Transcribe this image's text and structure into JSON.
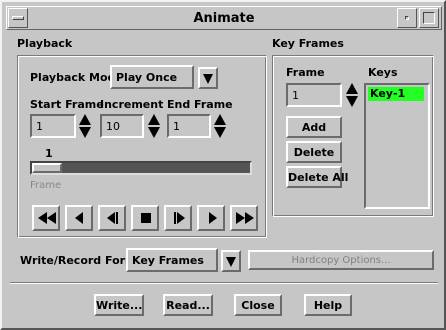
{
  "window": {
    "title": "Animate"
  },
  "playback": {
    "section_label": "Playback",
    "mode_label": "Playback Mode",
    "mode_value": "Play Once",
    "start_frame_label": "Start Frame",
    "start_frame_value": "1",
    "increment_label": "Increment",
    "increment_value": "10",
    "end_frame_label": "End Frame",
    "end_frame_value": "1",
    "slider_value_text": "1",
    "slider_label": "Frame",
    "transport_icons": [
      "fast-rewind",
      "step-back",
      "play-reverse",
      "stop",
      "play-forward",
      "step-forward",
      "fast-forward"
    ]
  },
  "keyframes": {
    "section_label": "Key Frames",
    "frame_label": "Frame",
    "frame_value": "1",
    "keys_label": "Keys",
    "keys": [
      "Key-1"
    ],
    "add_label": "Add",
    "delete_label": "Delete",
    "delete_all_label": "Delete All",
    "selected_color": "#22ff22"
  },
  "write_record": {
    "label": "Write/Record Format",
    "value": "Key Frames",
    "hardcopy_label": "Hardcopy Options..."
  },
  "footer": {
    "write_label": "Write...",
    "read_label": "Read...",
    "close_label": "Close",
    "help_label": "Help"
  }
}
